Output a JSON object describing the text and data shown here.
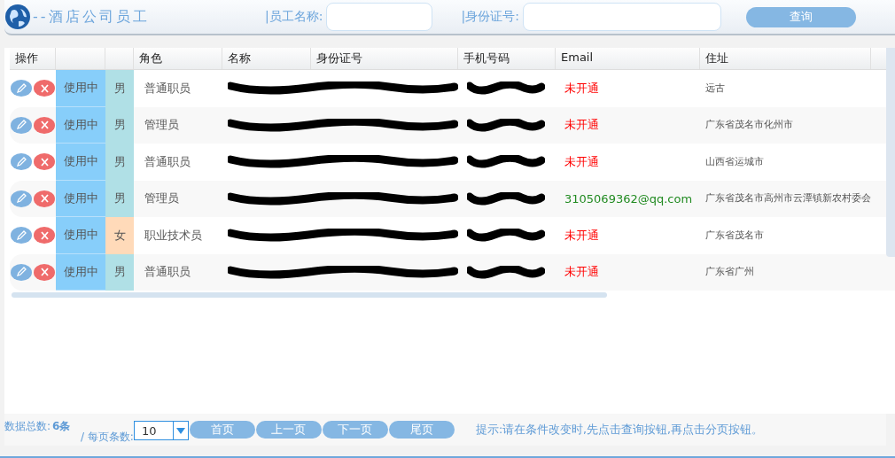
{
  "header": {
    "title": "--酒店公司员工",
    "name_label": "|员工名称:",
    "id_label": "|身份证号:",
    "search_button": "查询"
  },
  "table": {
    "columns": [
      "操作",
      "",
      "",
      "角色",
      "名称",
      "身份证号",
      "手机号码",
      "Email",
      "住址"
    ],
    "rows": [
      {
        "status": "使用中",
        "gender": "男",
        "color": "#b0e0e6",
        "role": "普通职员",
        "email_opened": false,
        "email": "未开通",
        "address": "远古"
      },
      {
        "status": "使用中",
        "gender": "男",
        "color": "#b0e0e6",
        "role": "管理员",
        "email_opened": false,
        "email": "未开通",
        "address": "广东省茂名市化州市"
      },
      {
        "status": "使用中",
        "gender": "男",
        "color": "#b0e0e6",
        "role": "普通职员",
        "email_opened": false,
        "email": "未开通",
        "address": "山西省运城市"
      },
      {
        "status": "使用中",
        "gender": "男",
        "color": "#b0e0e6",
        "role": "管理员",
        "email_opened": true,
        "email": "3105069362@qq.com",
        "address": "广东省茂名市高州市云潭镇新农村委会"
      },
      {
        "status": "使用中",
        "gender": "女",
        "color": "#ffdab9",
        "role": "职业技术员",
        "email_opened": false,
        "email": "未开通",
        "address": "广东省茂名市"
      },
      {
        "status": "使用中",
        "gender": "男",
        "color": "#b0e0e6",
        "role": "普通职员",
        "email_opened": false,
        "email": "未开通",
        "address": "广东省广州"
      }
    ]
  },
  "pager": {
    "total_label": "数据总数:",
    "total": "6条",
    "per_page_label": "/ 每页条数:",
    "per_page": "10",
    "buttons": [
      "首页",
      "上一页",
      "下一页",
      "尾页"
    ],
    "hint": "提示:请在条件改变时,先点击查询按钮,再点击分页按钮。"
  }
}
